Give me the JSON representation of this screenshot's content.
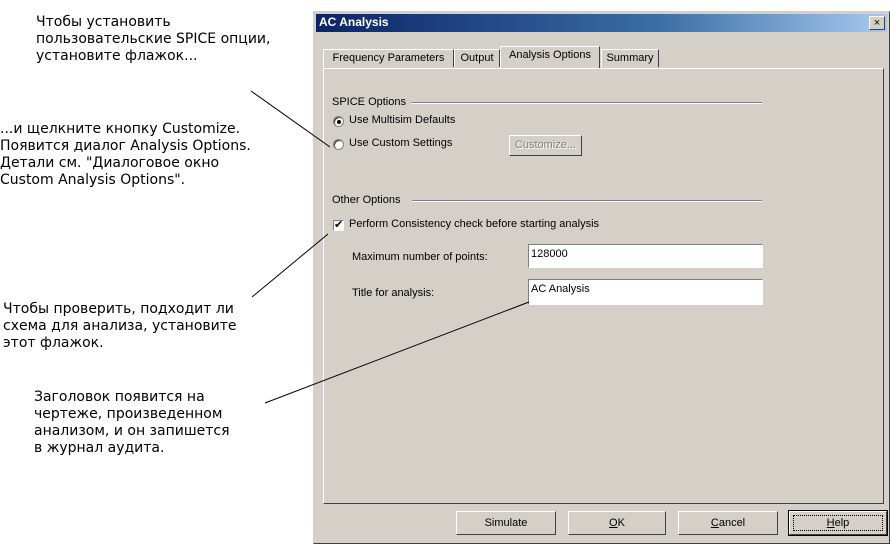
{
  "callouts": {
    "checkbox_custom": "Чтобы установить\nпользовательские SPICE опции,\nустановите флажок...",
    "customize_button": "...и щелкните кнопку Customize.\nПоявится диалог Analysis Options.\nДетали см. \"Диалоговое окно\nCustom Analysis Options\".",
    "consistency_check": "Чтобы проверить, подходит ли\nсхема для анализа, установите\nэтот флажок.",
    "title_field": "Заголовок появится на\nчертеже, произведенном\nанализом, и он запишется\nв журнал аудита."
  },
  "dialog": {
    "title": "AC Analysis",
    "close_glyph": "×",
    "tabs": [
      "Frequency Parameters",
      "Output",
      "Analysis Options",
      "Summary"
    ],
    "active_tab": "Analysis Options",
    "spice_options": {
      "group_label": "SPICE Options",
      "radio_defaults": "Use Multisim Defaults",
      "radio_custom": "Use Custom Settings",
      "selected": "Use Multisim Defaults",
      "customize_button": "Customize..."
    },
    "other_options": {
      "group_label": "Other Options",
      "consistency_check_label": "Perform Consistency check before starting analysis",
      "consistency_check_checked": true,
      "check_glyph": "✔",
      "max_points_label": "Maximum number of points:",
      "max_points_value": "128000",
      "title_label": "Title for analysis:",
      "title_value": "AC Analysis"
    },
    "buttons": {
      "simulate": "Simulate",
      "ok_mnemonic": "O",
      "ok_rest": "K",
      "cancel_mnemonic": "C",
      "cancel_rest": "ancel",
      "help_mnemonic": "H",
      "help_rest": "elp"
    }
  }
}
